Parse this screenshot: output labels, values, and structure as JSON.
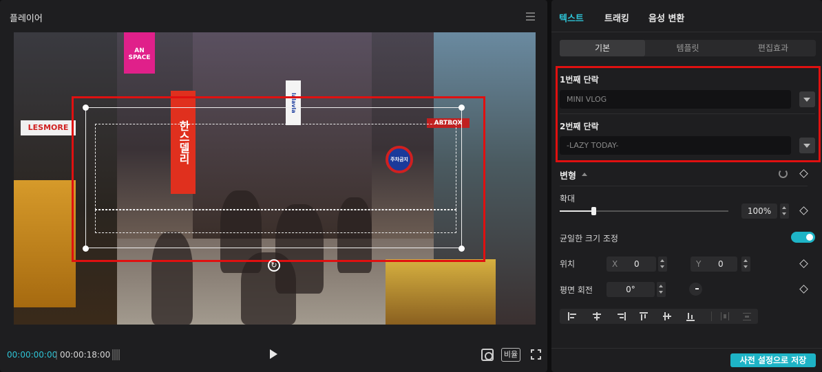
{
  "player": {
    "title": "플레이어",
    "current_time": "00:00:00:00",
    "duration": "00:00:18:00",
    "ratio_label": "비율",
    "scene_signs": {
      "red_sign": "한스델리",
      "pink_sign": "AN SPACE",
      "lesmore": "LESMORE",
      "blue_sign": "lalavla",
      "no_parking": "주차금지",
      "artbox": "ARTBOX"
    }
  },
  "panel": {
    "tabs": [
      {
        "label": "텍스트",
        "active": true
      },
      {
        "label": "트래킹",
        "active": false
      },
      {
        "label": "음성 변환",
        "active": false
      }
    ],
    "subtabs": [
      {
        "label": "기본",
        "active": true
      },
      {
        "label": "템플릿",
        "active": false
      },
      {
        "label": "편집효과",
        "active": false
      }
    ],
    "paragraphs": [
      {
        "label": "1번째 단락",
        "value": "MINI VLOG"
      },
      {
        "label": "2번째 단락",
        "value": "-LAZY TODAY-"
      }
    ],
    "transform": {
      "title": "변형",
      "scale_label": "확대",
      "scale_value": "100%",
      "scale_fraction": 0.2,
      "uniform_scale_label": "균일한 크기 조정",
      "uniform_scale_on": true,
      "position_label": "위치",
      "pos_x_axis": "X",
      "pos_x": "0",
      "pos_y_axis": "Y",
      "pos_y": "0",
      "rotation_label": "평면 회전",
      "rotation_value": "0°"
    },
    "save_preset_label": "사전 설정으로 저장"
  },
  "colors": {
    "accent": "#2ec4d6",
    "highlight_box": "#e01010",
    "panel_bg": "#1e1e20"
  }
}
